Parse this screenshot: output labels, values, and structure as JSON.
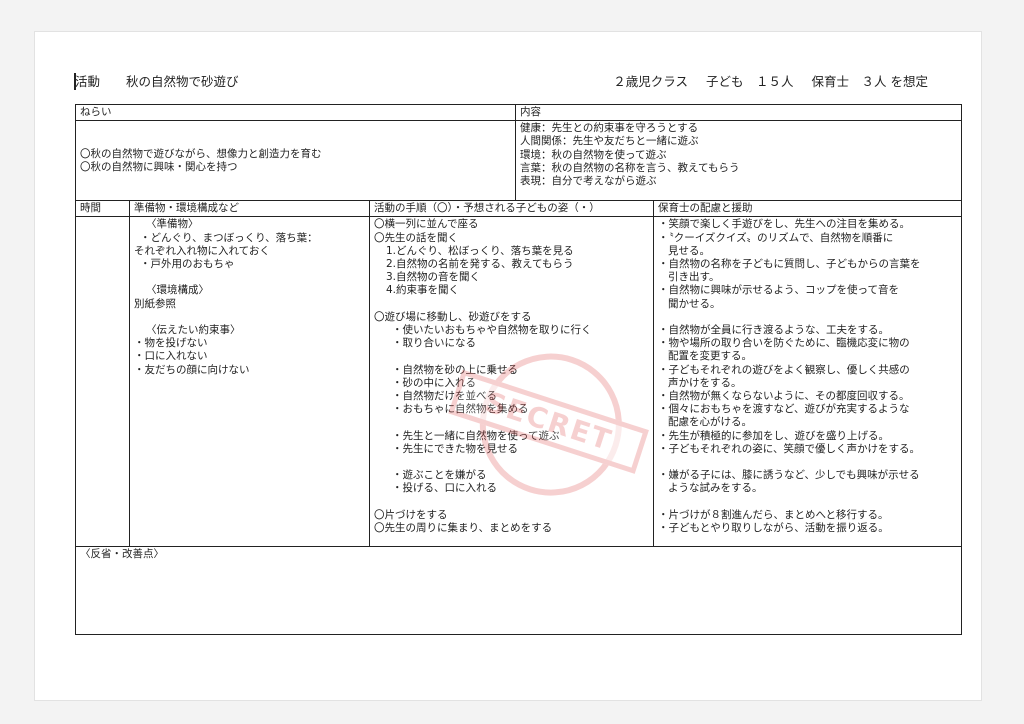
{
  "header": {
    "activity_label": "活動",
    "activity_title": "秋の自然物で砂遊び",
    "class_info": "２歳児クラス",
    "children_info": "子ども　１５人",
    "staff_info": "保育士　３人 を想定"
  },
  "aims": {
    "label": "ねらい",
    "items": [
      "〇秋の自然物で遊びながら、想像力と創造力を育む",
      "〇秋の自然物に興味・関心を持つ"
    ]
  },
  "content": {
    "label": "内容",
    "items": [
      "健康：先生との約束事を守ろうとする",
      "人間関係：先生や友だちと一緒に遊ぶ",
      "環境：秋の自然物を使って遊ぶ",
      "言葉：秋の自然物の名称を言う、教えてもらう",
      "表現：自分で考えながら遊ぶ"
    ]
  },
  "columns": {
    "time": "時間",
    "prep": "準備物・環境構成など",
    "procedure": "活動の手順（〇）・予想される子どもの姿（・）",
    "support": "保育士の配慮と援助"
  },
  "prep": {
    "l1": "〈準備物〉",
    "l2": "・どんぐり、まつぼっくり、落ち葉：",
    "l3": "それぞれ入れ物に入れておく",
    "l4": "・戸外用のおもちゃ",
    "l5": "〈環境構成〉",
    "l6": "別紙参照",
    "l7": "〈伝えたい約束事〉",
    "l8": "・物を投げない",
    "l9": "・口に入れない",
    "l10": "・友だちの顔に向けない"
  },
  "procedure": {
    "l1": "〇横一列に並んで座る",
    "l2": "〇先生の話を聞く",
    "l3": "1.どんぐり、松ぼっくり、落ち葉を見る",
    "l4": "2.自然物の名前を発する、教えてもらう",
    "l5": "3.自然物の音を聞く",
    "l6": "4.約束事を聞く",
    "l7": "〇遊び場に移動し、砂遊びをする",
    "l8": "・使いたいおもちゃや自然物を取りに行く",
    "l9": "・取り合いになる",
    "l10": "・自然物を砂の上に乗せる",
    "l11": "・砂の中に入れる",
    "l12": "・自然物だけを並べる",
    "l13": "・おもちゃに自然物を集める",
    "l14": "・先生と一緒に自然物を使って遊ぶ",
    "l15": "・先生にできた物を見せる",
    "l16": "・遊ぶことを嫌がる",
    "l17": "・投げる、口に入れる",
    "l18": "〇片づけをする",
    "l19": "〇先生の周りに集まり、まとめをする"
  },
  "support": {
    "l1": "・笑顔で楽しく手遊びをし、先生への注目を集める。",
    "l2": "・〝クーイズクイズ〟のリズムで、自然物を順番に",
    "l3": "見せる。",
    "l4": "・自然物の名称を子どもに質問し、子どもからの言葉を",
    "l5": "引き出す。",
    "l6": "・自然物に興味が示せるよう、コップを使って音を",
    "l7": "聞かせる。",
    "l8": "・自然物が全員に行き渡るような、工夫をする。",
    "l9": "・物や場所の取り合いを防ぐために、臨機応変に物の",
    "l10": "配置を変更する。",
    "l11": "・子どもそれぞれの遊びをよく観察し、優しく共感の",
    "l12": "声かけをする。",
    "l13": "・自然物が無くならないように、その都度回収する。",
    "l14": "・個々におもちゃを渡すなど、遊びが充実するような",
    "l15": "配慮を心がける。",
    "l16": "・先生が積極的に参加をし、遊びを盛り上げる。",
    "l17": "・子どもそれぞれの姿に、笑顔で優しく声かけをする。",
    "l18": "・嫌がる子には、膝に誘うなど、少しでも興味が示せる",
    "l19": "ような試みをする。",
    "l20": "・片づけが８割進んだら、まとめへと移行する。",
    "l21": "・子どもとやり取りしながら、活動を振り返る。"
  },
  "reflection": {
    "label": "〈反省・改善点〉"
  },
  "stamp": {
    "text": "SECRET",
    "color": "#e25a5a"
  }
}
